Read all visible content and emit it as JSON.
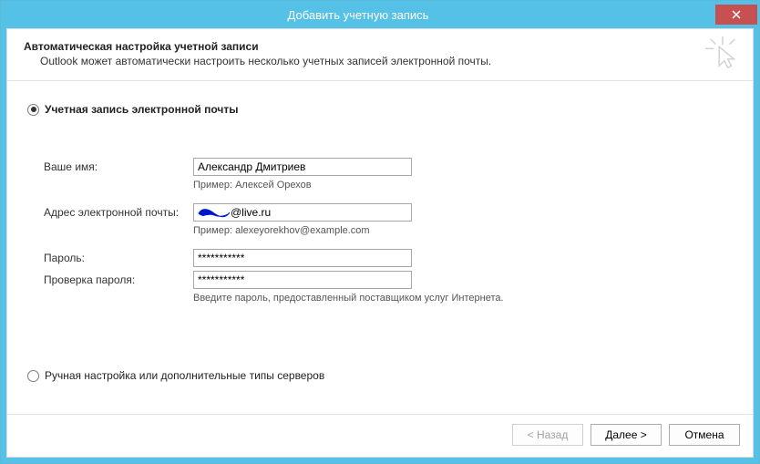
{
  "window": {
    "title": "Добавить учетную запись"
  },
  "header": {
    "title": "Автоматическая настройка учетной записи",
    "subtitle": "Outlook может автоматически настроить несколько учетных записей электронной почты."
  },
  "options": {
    "email_account_label": "Учетная запись электронной почты",
    "manual_label": "Ручная настройка или дополнительные типы серверов"
  },
  "form": {
    "name_label": "Ваше имя:",
    "name_value": "Александр Дмитриев",
    "name_hint": "Пример: Алексей Орехов",
    "email_label": "Адрес электронной почты:",
    "email_visible_suffix": "@live.ru",
    "email_hint": "Пример: alexeyorekhov@example.com",
    "password_label": "Пароль:",
    "password_value": "***********",
    "password_confirm_label": "Проверка пароля:",
    "password_confirm_value": "***********",
    "password_hint": "Введите пароль, предоставленный поставщиком услуг Интернета."
  },
  "footer": {
    "back_label": "< Назад",
    "next_label": "Далее >",
    "cancel_label": "Отмена"
  }
}
